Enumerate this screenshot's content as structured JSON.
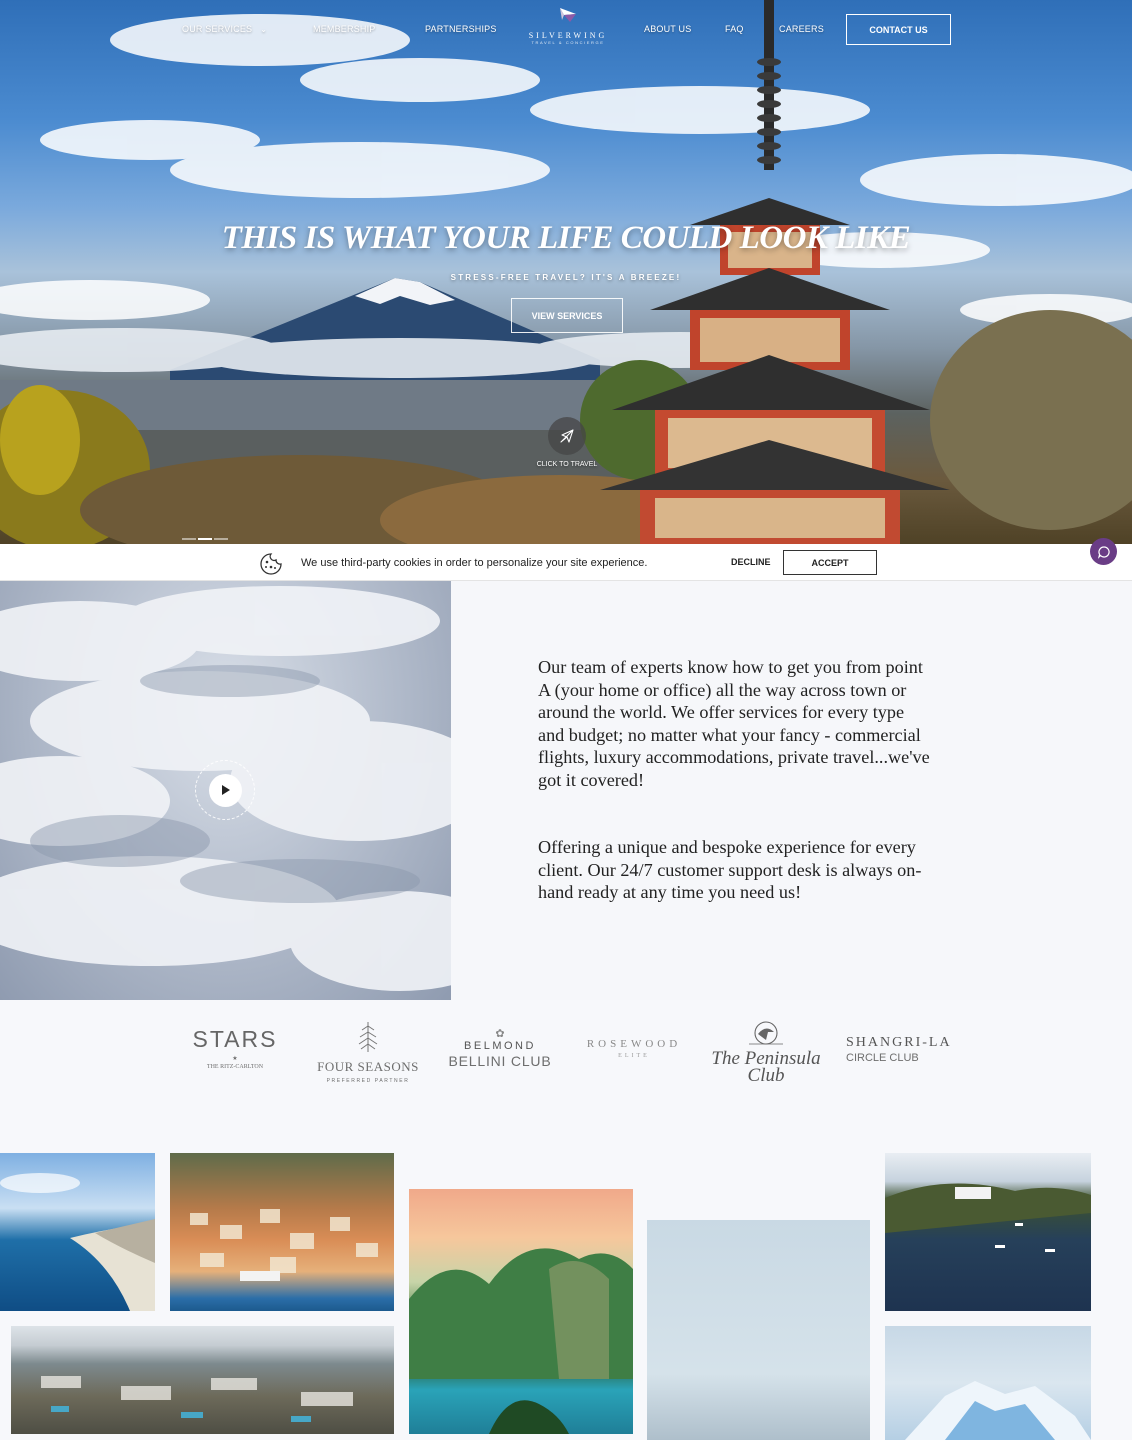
{
  "nav": {
    "items": [
      {
        "label": "OUR SERVICES"
      },
      {
        "label": "MEMBERSHIP"
      },
      {
        "label": "PARTNERSHIPS"
      },
      {
        "label": "ABOUT US"
      },
      {
        "label": "FAQ"
      },
      {
        "label": "CAREERS"
      }
    ],
    "contact_label": "CONTACT US"
  },
  "logo": {
    "name": "SILVERWING",
    "tagline": "TRAVEL & CONCIERGE"
  },
  "hero": {
    "title": "THIS IS WHAT YOUR LIFE COULD LOOK LIKE",
    "subtitle": "STRESS-FREE TRAVEL? IT'S A BREEZE!",
    "cta_label": "VIEW SERVICES",
    "travel_label": "CLICK TO TRAVEL"
  },
  "cookie_bar": {
    "message": "We use third-party cookies in order to personalize your site experience.",
    "decline_label": "DECLINE",
    "accept_label": "ACCEPT"
  },
  "about": {
    "paragraph_1": "Our team of experts know how to get you from point A (your home or office) all the way across town or around the world. We offer services for every type and budget; no matter what your fancy - commercial flights, luxury accommodations, private travel...we've got it covered!",
    "paragraph_2": "Offering a unique and bespoke experience for every client. Our 24/7 customer support desk is always on-hand ready at any time you need us!"
  },
  "partners": [
    {
      "name": "STARS",
      "sub": "THE RITZ-CARLTON"
    },
    {
      "name": "FOUR SEASONS",
      "sub": "PREFERRED PARTNER"
    },
    {
      "name": "BELMOND",
      "sub": "BELLINI CLUB"
    },
    {
      "name": "ROSEWOOD",
      "sub": "ELITE"
    },
    {
      "name": "The Peninsula",
      "sub": "Club"
    },
    {
      "name": "SHANGRI-LA",
      "sub": "CIRCLE CLUB"
    }
  ],
  "colors": {
    "accent": "#6a3d86",
    "text": "#222222",
    "muted": "#6e6e6e"
  }
}
